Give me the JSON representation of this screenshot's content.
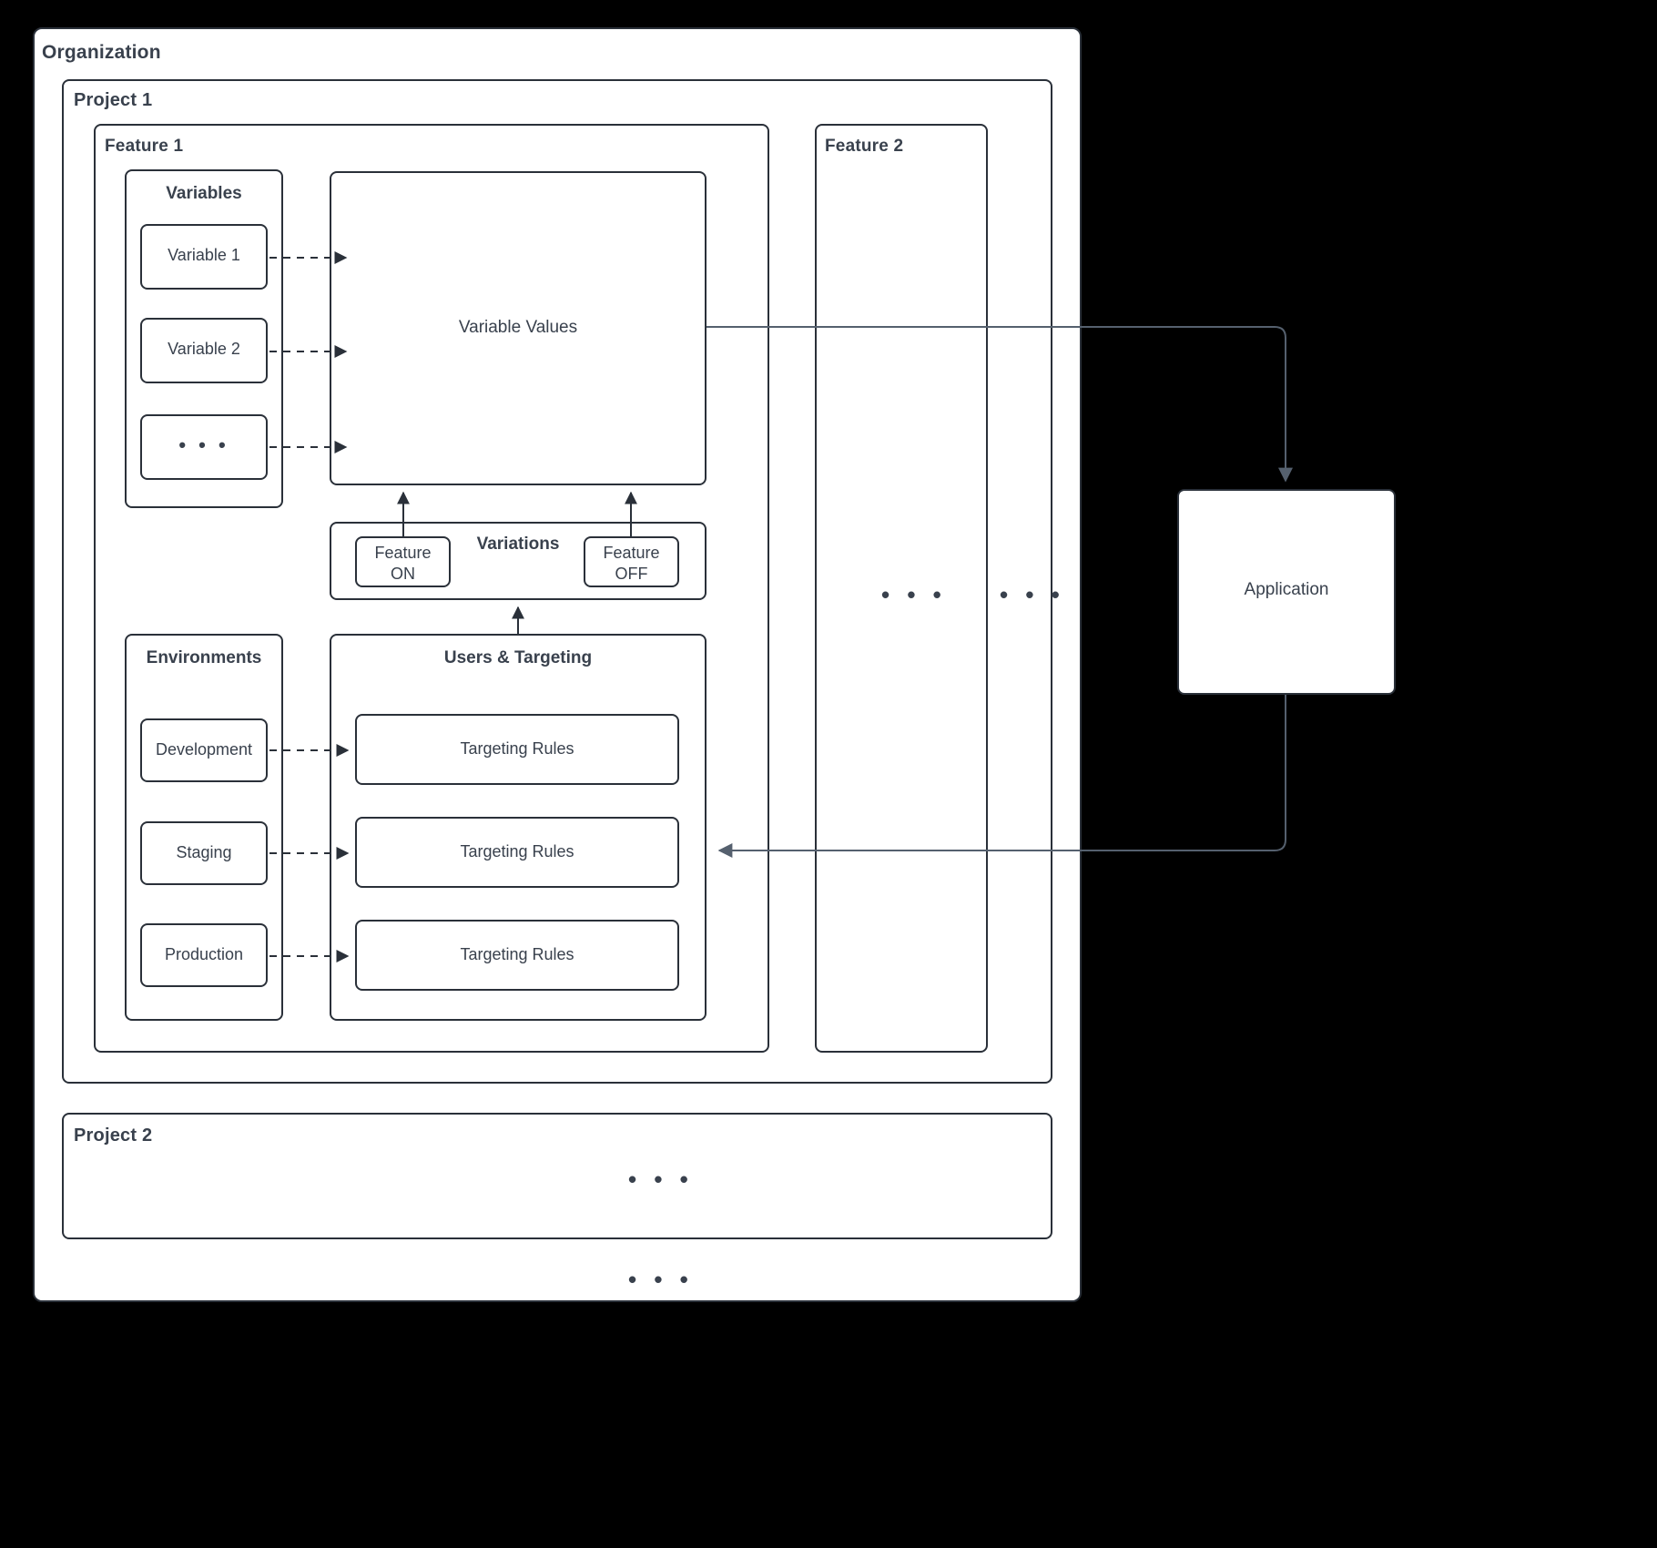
{
  "diagram": {
    "title_hidden": "",
    "organization": {
      "label": "Organization"
    },
    "project1": {
      "label": "Project 1"
    },
    "project2": {
      "label": "Project 2",
      "ellipsis": "• • •"
    },
    "feature1": {
      "label": "Feature 1"
    },
    "feature2": {
      "label": "Feature 2",
      "ellipsis": "• • •"
    },
    "more_features_ellipsis": "• • •",
    "more_projects_ellipsis": "• • •",
    "variables": {
      "label": "Variables",
      "items": [
        {
          "label": "Variable 1"
        },
        {
          "label": "Variable 2"
        },
        {
          "label": "• • •"
        }
      ]
    },
    "variable_values": {
      "label": "Variable Values"
    },
    "variations": {
      "label": "Variations",
      "on": {
        "line1": "Feature",
        "line2": "ON"
      },
      "off": {
        "line1": "Feature",
        "line2": "OFF"
      }
    },
    "environments": {
      "label": "Environments",
      "items": [
        {
          "label": "Development"
        },
        {
          "label": "Staging"
        },
        {
          "label": "Production"
        }
      ]
    },
    "users_targeting": {
      "label": "Users & Targeting",
      "rules": [
        {
          "label": "Targeting Rules"
        },
        {
          "label": "Targeting Rules"
        },
        {
          "label": "Targeting Rules"
        }
      ]
    },
    "application": {
      "label": "Application"
    },
    "colors": {
      "background": "#000000",
      "surface": "#ffffff",
      "stroke": "#2a3039",
      "text": "#39414d",
      "connector": "#55606e"
    }
  }
}
